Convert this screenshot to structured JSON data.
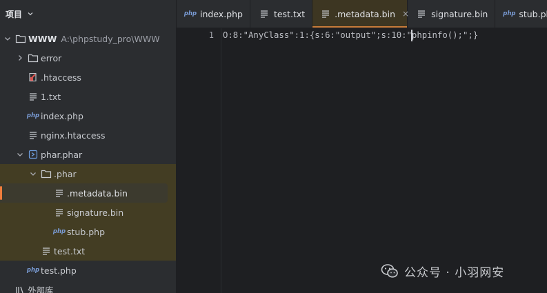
{
  "project": {
    "title": "项目",
    "tree": [
      {
        "name": "WWW",
        "path": "A:\\phpstudy_pro\\WWW",
        "icon": "folder-icon",
        "expanded": true
      },
      {
        "name": "error",
        "icon": "folder-icon",
        "expanded": false
      },
      {
        "name": ".htaccess",
        "icon": "htaccess-icon"
      },
      {
        "name": "1.txt",
        "icon": "text-file-icon"
      },
      {
        "name": "index.php",
        "icon": "php-file-icon"
      },
      {
        "name": "nginx.htaccess",
        "icon": "text-file-icon"
      },
      {
        "name": "phar.phar",
        "icon": "archive-icon",
        "expanded": true
      },
      {
        "name": ".phar",
        "icon": "folder-icon",
        "expanded": true
      },
      {
        "name": ".metadata.bin",
        "icon": "text-file-icon",
        "selected": true
      },
      {
        "name": "signature.bin",
        "icon": "text-file-icon"
      },
      {
        "name": "stub.php",
        "icon": "php-file-icon"
      },
      {
        "name": "test.txt",
        "icon": "text-file-icon"
      },
      {
        "name": "test.php",
        "icon": "php-file-icon"
      },
      {
        "name": "外部库",
        "icon": "library-icon"
      }
    ]
  },
  "tabs": [
    {
      "label": "index.php",
      "icon": "php-file-icon"
    },
    {
      "label": "test.txt",
      "icon": "text-file-icon"
    },
    {
      "label": ".metadata.bin",
      "icon": "text-file-icon",
      "active": true,
      "close": "×"
    },
    {
      "label": "signature.bin",
      "icon": "text-file-icon"
    },
    {
      "label": "stub.php",
      "icon": "php-file-icon"
    }
  ],
  "editor": {
    "line_number": "1",
    "code": "O:8:\"AnyClass\":1:{s:6:\"output\";s:10:\"phpinfo();\";}"
  },
  "php_icon_text": "php",
  "watermark": "公众号 · 小羽网安",
  "colors": {
    "background": "#2b2d30",
    "editor": "#1e1f22",
    "accent": "#c87c3a",
    "phar_highlight": "#433d23"
  }
}
